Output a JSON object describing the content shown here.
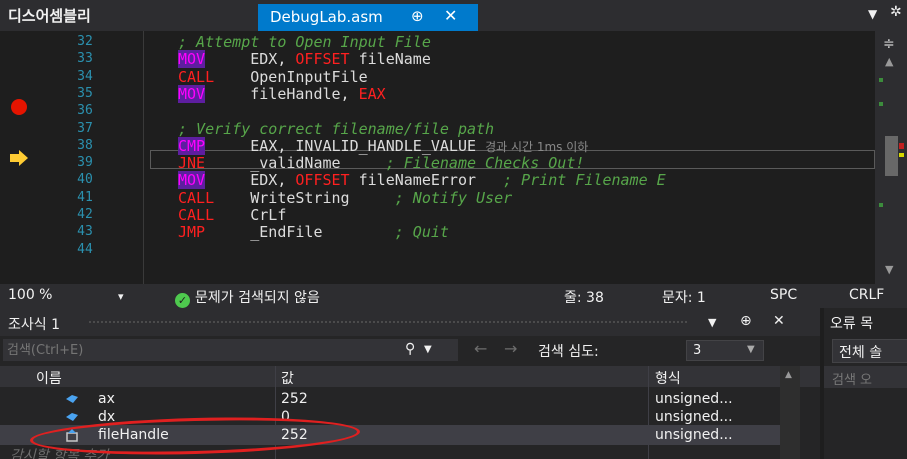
{
  "window": {
    "panel_title": "디스어셈블리",
    "tab_name": "DebugLab.asm",
    "tab_pin": "⊕",
    "tab_close": "✕"
  },
  "editor": {
    "lines": [
      {
        "num": "32",
        "tokens": [
          {
            "t": "; Attempt to Open Input File",
            "k": "comment"
          }
        ]
      },
      {
        "num": "33",
        "tokens": [
          {
            "t": "MOV",
            "k": "instr-hl"
          },
          {
            "t": "     EDX, ",
            "k": "plain"
          },
          {
            "t": "OFFSET",
            "k": "kw"
          },
          {
            "t": " fileName",
            "k": "plain"
          }
        ]
      },
      {
        "num": "34",
        "tokens": [
          {
            "t": "CALL",
            "k": "kw"
          },
          {
            "t": "    OpenInputFile",
            "k": "plain"
          }
        ]
      },
      {
        "num": "35",
        "tokens": [
          {
            "t": "MOV",
            "k": "instr-hl"
          },
          {
            "t": "     fileHandle, ",
            "k": "plain"
          },
          {
            "t": "EAX",
            "k": "kw"
          }
        ]
      },
      {
        "num": "36",
        "tokens": []
      },
      {
        "num": "37",
        "tokens": [
          {
            "t": "; Verify correct filename/file path",
            "k": "comment"
          }
        ]
      },
      {
        "num": "38",
        "tokens": [
          {
            "t": "CMP",
            "k": "instr-hl"
          },
          {
            "t": "     EAX, INVALID_HANDLE_VALUE ",
            "k": "plain"
          },
          {
            "t": "경과 시간 1ms 이하",
            "k": "time"
          }
        ]
      },
      {
        "num": "39",
        "tokens": [
          {
            "t": "JNE",
            "k": "kw"
          },
          {
            "t": "     _validName     ",
            "k": "plain"
          },
          {
            "t": "; Filename Checks Out!",
            "k": "comment"
          }
        ]
      },
      {
        "num": "40",
        "tokens": [
          {
            "t": "MOV",
            "k": "instr-hl"
          },
          {
            "t": "     EDX, ",
            "k": "plain"
          },
          {
            "t": "OFFSET",
            "k": "kw"
          },
          {
            "t": " fileNameError   ",
            "k": "plain"
          },
          {
            "t": "; Print Filename E",
            "k": "comment"
          }
        ]
      },
      {
        "num": "41",
        "tokens": [
          {
            "t": "CALL",
            "k": "kw"
          },
          {
            "t": "    WriteString     ",
            "k": "plain"
          },
          {
            "t": "; Notify User",
            "k": "comment"
          }
        ]
      },
      {
        "num": "42",
        "tokens": [
          {
            "t": "CALL",
            "k": "kw"
          },
          {
            "t": "    CrLf",
            "k": "plain"
          }
        ]
      },
      {
        "num": "43",
        "tokens": [
          {
            "t": "JMP",
            "k": "kw"
          },
          {
            "t": "     _EndFile        ",
            "k": "plain"
          },
          {
            "t": "; Quit",
            "k": "comment"
          }
        ]
      },
      {
        "num": "44",
        "tokens": []
      }
    ]
  },
  "statusbar": {
    "zoom": "100 %",
    "zoom_dropdown": "▾",
    "issues": "문제가 검색되지 않음",
    "line": "줄: 38",
    "char": "문자: 1",
    "spc": "SPC",
    "crlf": "CRLF"
  },
  "watch": {
    "title": "조사식 1",
    "search_placeholder": "검색(Ctrl+E)",
    "search_depth_label": "검색 심도:",
    "search_depth_value": "3",
    "columns": {
      "name": "이름",
      "value": "값",
      "type": "형식"
    },
    "rows": [
      {
        "name": "ax",
        "value": "252",
        "type": "unsigned...",
        "icon": "variable-icon"
      },
      {
        "name": "dx",
        "value": "0",
        "type": "unsigned...",
        "icon": "variable-icon"
      },
      {
        "name": "fileHandle",
        "value": "252",
        "type": "unsigned...",
        "icon": "memory-variable-icon"
      }
    ],
    "add_watch": "감시할 항목 추가"
  },
  "errlist": {
    "title": "오류 목",
    "filter": "전체 솔",
    "search": "검색 오"
  },
  "colors": {
    "accent": "#007acc",
    "breakpoint": "#e51400",
    "exec_arrow": "#ffcc33",
    "annotation": "#e02020"
  }
}
